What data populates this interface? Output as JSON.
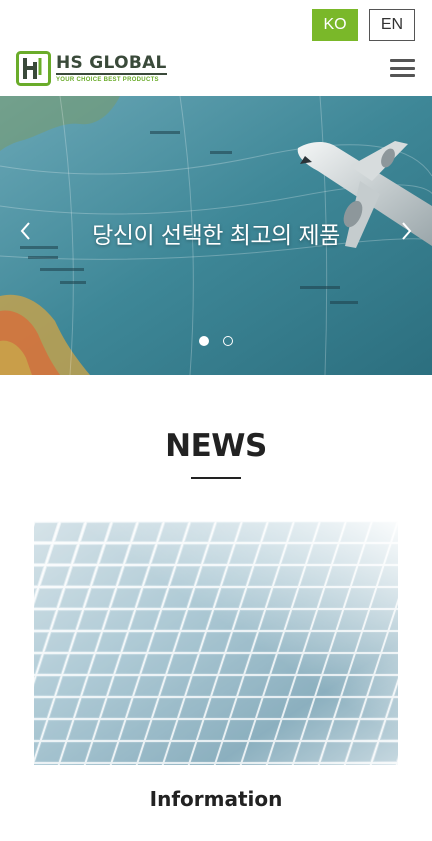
{
  "language": {
    "ko_label": "KO",
    "en_label": "EN",
    "active": "KO"
  },
  "header": {
    "logo_name": "HS GLOBAL",
    "logo_tagline": "YOUR CHOICE BEST PRODUCTS",
    "menu_icon": "hamburger-menu-icon"
  },
  "hero": {
    "slide_title": "당신이 선택한 최고의 제품",
    "prev_icon": "chevron-left-icon",
    "next_icon": "chevron-right-icon",
    "slide_count": 2,
    "active_slide": 1
  },
  "news": {
    "section_title": "NEWS",
    "cards": [
      {
        "caption": "Information",
        "image": "glass-building-facade"
      }
    ]
  },
  "colors": {
    "accent_green": "#7ab829",
    "logo_dark": "#3a4a3a",
    "text": "#222222"
  }
}
